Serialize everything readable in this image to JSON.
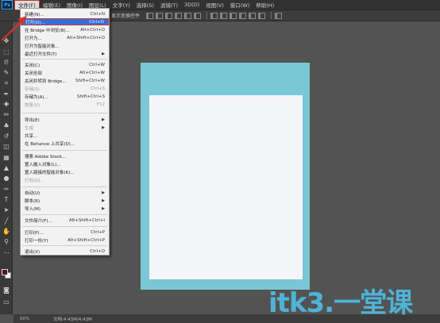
{
  "app": {
    "logo": "Ps",
    "accent_color": "#31a8ff",
    "annotation_color": "#d8322a"
  },
  "menubar": {
    "items": [
      "文件(F)",
      "编辑(E)",
      "图像(I)",
      "图层(L)",
      "文字(Y)",
      "选择(S)",
      "滤镜(T)",
      "3D(D)",
      "视图(V)",
      "窗口(W)",
      "帮助(H)"
    ],
    "active_index": 0
  },
  "options_bar": {
    "auto_show_label": "显示变换控件"
  },
  "file_menu": {
    "items": [
      {
        "label": "新建(N)...",
        "shortcut": "Ctrl+N"
      },
      {
        "label": "打开(O)...",
        "shortcut": "Ctrl+O",
        "highlight": true
      },
      {
        "label": "在 Bridge 中浏览(B)...",
        "shortcut": "Alt+Ctrl+O"
      },
      {
        "label": "打开为...",
        "shortcut": "Alt+Shift+Ctrl+O"
      },
      {
        "label": "打开为智能对象...",
        "shortcut": ""
      },
      {
        "label": "最近打开文件(T)",
        "shortcut": "",
        "submenu": true
      },
      {
        "label": "关闭(C)",
        "shortcut": "Ctrl+W"
      },
      {
        "label": "关闭全部",
        "shortcut": "Alt+Ctrl+W"
      },
      {
        "label": "关闭并转到 Bridge...",
        "shortcut": "Shift+Ctrl+W"
      },
      {
        "label": "存储(S)",
        "shortcut": "Ctrl+S",
        "disabled": true
      },
      {
        "label": "存储为(A)...",
        "shortcut": "Shift+Ctrl+S"
      },
      {
        "label": "恢复(V)",
        "shortcut": "F12",
        "disabled": true
      },
      {
        "label": "导出(E)",
        "shortcut": "",
        "submenu": true
      },
      {
        "label": "生成",
        "shortcut": "",
        "submenu": true,
        "disabled": true
      },
      {
        "label": "共享...",
        "shortcut": ""
      },
      {
        "label": "在 Behance 上共享(D)...",
        "shortcut": ""
      },
      {
        "label": "搜索 Adobe Stock...",
        "shortcut": ""
      },
      {
        "label": "置入嵌入对象(L)...",
        "shortcut": ""
      },
      {
        "label": "置入链接的智能对象(K)...",
        "shortcut": ""
      },
      {
        "label": "打包(G)...",
        "shortcut": "",
        "disabled": true
      },
      {
        "label": "自动(U)",
        "shortcut": "",
        "submenu": true
      },
      {
        "label": "脚本(R)",
        "shortcut": "",
        "submenu": true
      },
      {
        "label": "导入(M)",
        "shortcut": "",
        "submenu": true
      },
      {
        "label": "文件简介(F)...",
        "shortcut": "Alt+Shift+Ctrl+I"
      },
      {
        "label": "打印(P)...",
        "shortcut": "Ctrl+P"
      },
      {
        "label": "打印一份(Y)",
        "shortcut": "Alt+Shift+Ctrl+P"
      },
      {
        "label": "退出(X)",
        "shortcut": "Ctrl+Q"
      }
    ]
  },
  "toolbox": {
    "icons": [
      "move-icon",
      "marquee-icon",
      "lasso-icon",
      "quick-select-icon",
      "crop-icon",
      "eyedropper-icon",
      "healing-brush-icon",
      "brush-icon",
      "clone-stamp-icon",
      "history-brush-icon",
      "eraser-icon",
      "gradient-icon",
      "blur-icon",
      "dodge-icon",
      "pen-icon",
      "type-icon",
      "path-select-icon",
      "shape-icon",
      "hand-icon",
      "zoom-icon",
      "more-tools-icon"
    ],
    "foreground_color": "#5b1414",
    "background_color": "#ffffff"
  },
  "document": {
    "outer_color": "#7ac7d6",
    "inner_color": "#f4f5f9"
  },
  "status_bar": {
    "zoom": "50%",
    "doc_info": "文档:4.43M/4.43M"
  },
  "watermark": "itk3.一堂课"
}
